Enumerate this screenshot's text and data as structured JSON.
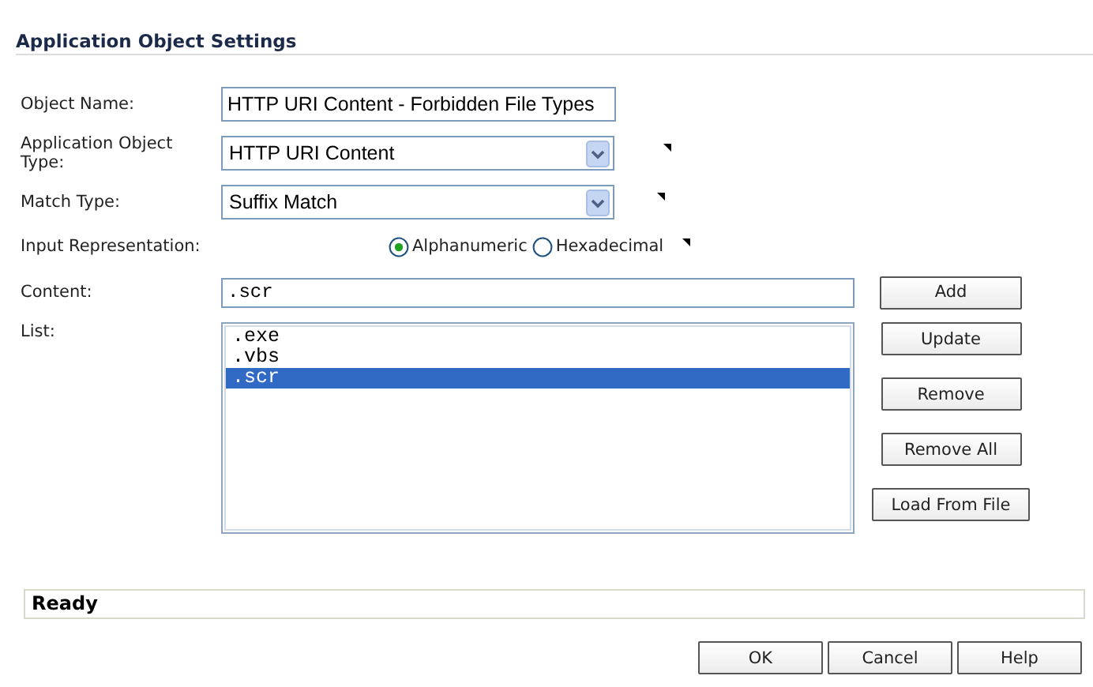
{
  "section_title": "Application Object Settings",
  "fields": [
    {
      "kind": "text",
      "label": "Object Name:",
      "value": "HTTP URI Content - Forbidden File Types"
    },
    {
      "kind": "select",
      "label": "Application Object Type:",
      "value": "HTTP URI Content"
    },
    {
      "kind": "select",
      "label": "Match Type:",
      "value": "Suffix Match"
    },
    {
      "kind": "radio",
      "label": "Input Representation:",
      "options": [
        {
          "label": "Alphanumeric",
          "selected": true
        },
        {
          "label": "Hexadecimal",
          "selected": false
        }
      ]
    }
  ],
  "content": {
    "label": "Content:",
    "value": ".scr"
  },
  "list": {
    "label": "List:",
    "items": [
      {
        "text": ".exe",
        "selected": false
      },
      {
        "text": ".vbs",
        "selected": false
      },
      {
        "text": ".scr",
        "selected": true
      }
    ]
  },
  "side_buttons": [
    "Add",
    "Update",
    "Remove",
    "Remove All",
    "Load From File"
  ],
  "status": "Ready",
  "buttons": [
    "OK",
    "Cancel",
    "Help"
  ]
}
